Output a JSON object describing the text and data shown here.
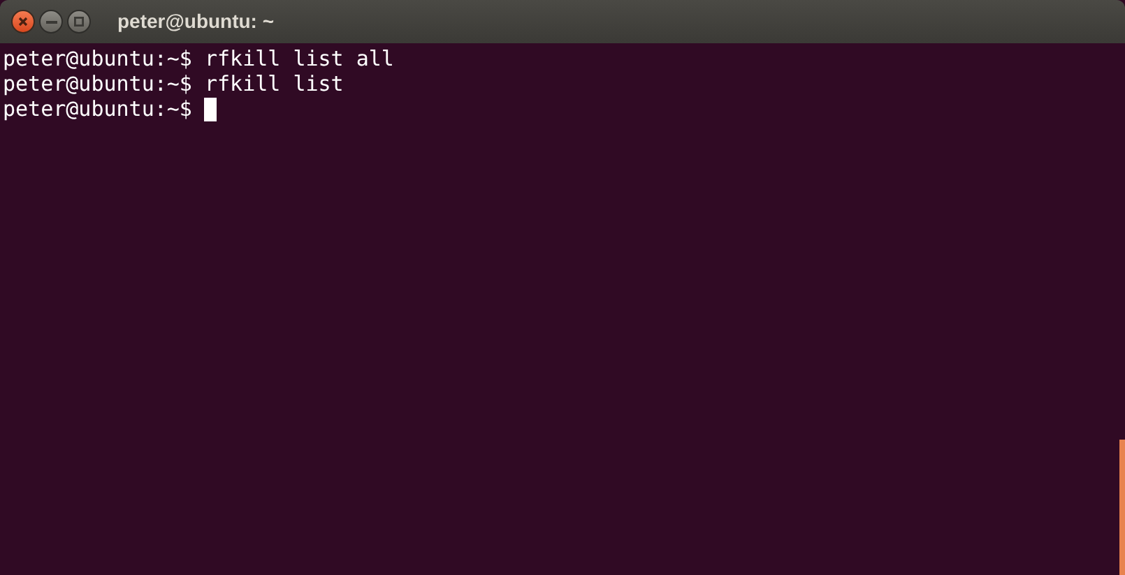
{
  "window": {
    "title": "peter@ubuntu: ~"
  },
  "terminal": {
    "lines": [
      {
        "text": "peter@ubuntu:~$ rfkill list all",
        "cursor": false
      },
      {
        "text": "peter@ubuntu:~$ rfkill list",
        "cursor": false
      },
      {
        "text": "peter@ubuntu:~$",
        "cursor": true
      }
    ]
  }
}
